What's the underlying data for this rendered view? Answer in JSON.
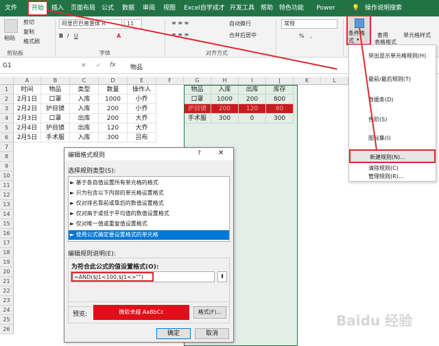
{
  "ribbon_tabs": [
    "文件",
    "开始",
    "插入",
    "页面布局",
    "公式",
    "数据",
    "审阅",
    "视图",
    "Excel自学成才",
    "开发工具",
    "帮助",
    "特色功能",
    "Power Pivot",
    "操作说明搜索"
  ],
  "clipboard": {
    "paste": "粘贴",
    "cut": "剪切",
    "copy": "复制",
    "format_painter": "格式刷",
    "group": "剪贴板"
  },
  "font": {
    "name": "阿里巴巴普惠体 R",
    "size": "11",
    "group": "字体"
  },
  "alignment": {
    "wrap": "自动换行",
    "merge": "合并后居中",
    "group": "对齐方式"
  },
  "number": {
    "format": "常规",
    "pct": "%",
    "comma": ","
  },
  "styles": {
    "conditional": "条件格式",
    "table_a": "套用",
    "table_b": "表格格式",
    "cell_a": "单元格样式"
  },
  "formula_bar": {
    "cell_ref": "G1",
    "value": "物品"
  },
  "columns": [
    "A",
    "B",
    "C",
    "D",
    "E",
    "F",
    "G",
    "H",
    "I",
    "J",
    "K",
    "L"
  ],
  "rows": [
    "1",
    "2",
    "3",
    "4",
    "5",
    "6",
    "7",
    "8",
    "9",
    "10",
    "11",
    "12",
    "13",
    "14",
    "15",
    "16",
    "17",
    "18",
    "19",
    "20",
    "21",
    "22",
    "23",
    "24",
    "25",
    "26"
  ],
  "table1": {
    "headers": [
      "时间",
      "物品",
      "类型",
      "数量",
      "操作人"
    ],
    "rows": [
      [
        "2月1日",
        "口罩",
        "入库",
        "1000",
        "小乔"
      ],
      [
        "2月2日",
        "护目镜",
        "入库",
        "200",
        "小乔"
      ],
      [
        "2月3日",
        "口罩",
        "出库",
        "200",
        "大乔"
      ],
      [
        "2月4日",
        "护目镜",
        "出库",
        "120",
        "大乔"
      ],
      [
        "2月5日",
        "手术服",
        "入库",
        "300",
        "吕布"
      ]
    ]
  },
  "table2": {
    "headers": [
      "物品",
      "入库",
      "出库",
      "库存"
    ],
    "rows": [
      [
        "口罩",
        "1000",
        "200",
        "800"
      ],
      [
        "护目镜",
        "200",
        "120",
        "80"
      ],
      [
        "手术服",
        "300",
        "0",
        "300"
      ]
    ],
    "highlight_color": "#e0101a"
  },
  "menu": {
    "items": [
      "突出显示单元格规则(H)",
      "最前/最后规则(T)",
      "数据条(D)",
      "色阶(S)",
      "图标集(I)",
      "新建规则(N)...",
      "清除规则(C)",
      "管理规则(R)..."
    ]
  },
  "dialog": {
    "title": "编辑格式规则",
    "help": "?",
    "select_type_label": "选择规则类型(S):",
    "rule_types": [
      "► 基于各自值设置所有单元格的格式",
      "► 只为包含以下内容的单元格设置格式",
      "► 仅对排名靠前或靠后的数值设置格式",
      "► 仅对高于或低于平均值的数值设置格式",
      "► 仅对唯一值或重复值设置格式",
      "► 使用公式确定要设置格式的单元格"
    ],
    "edit_desc_label": "编辑规则说明(E):",
    "formula_label": "为符合此公式的值设置格式(O):",
    "formula": "=AND($J1<100,$J1<>\"\")",
    "preview_label": "预览:",
    "preview_text": "微软卓越  AaBbCc",
    "format_button": "格式(F)...",
    "ok": "确定",
    "cancel": "取消"
  },
  "watermark": "Baidu 经验",
  "accent": "#217346",
  "red": "#e0262c"
}
